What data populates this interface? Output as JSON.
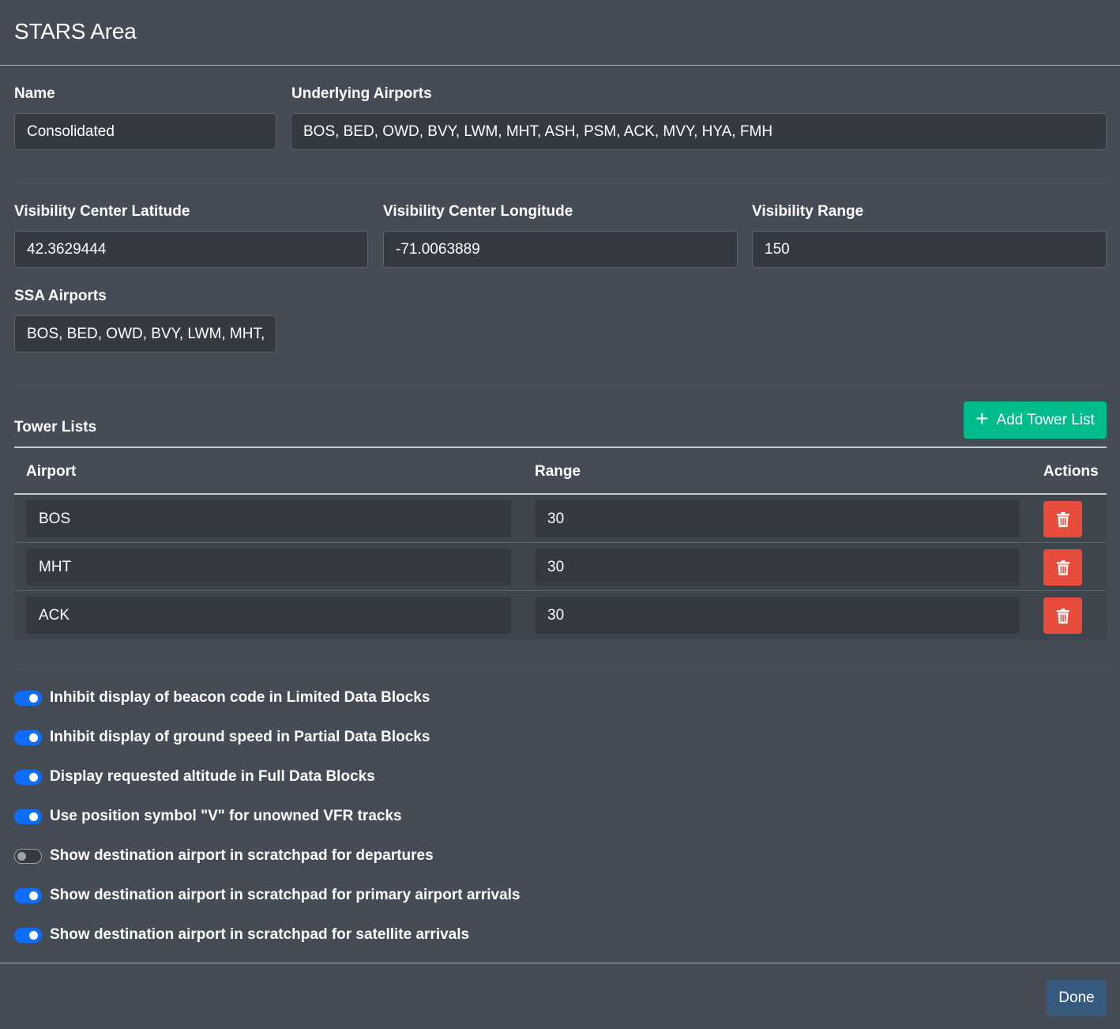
{
  "dialog": {
    "title": "STARS Area"
  },
  "fields": {
    "name": {
      "label": "Name",
      "value": "Consolidated"
    },
    "underlying_airports": {
      "label": "Underlying Airports",
      "value": "BOS, BED, OWD, BVY, LWM, MHT, ASH, PSM, ACK, MVY, HYA, FMH"
    },
    "latitude": {
      "label": "Visibility Center Latitude",
      "value": "42.3629444"
    },
    "longitude": {
      "label": "Visibility Center Longitude",
      "value": "-71.0063889"
    },
    "range": {
      "label": "Visibility Range",
      "value": "150"
    },
    "ssa_airports": {
      "label": "SSA Airports",
      "value": "BOS, BED, OWD, BVY, LWM, MHT, ASH"
    }
  },
  "tower_lists": {
    "heading": "Tower Lists",
    "add_button": "Add Tower List",
    "columns": {
      "airport": "Airport",
      "range": "Range",
      "actions": "Actions"
    },
    "rows": [
      {
        "airport": "BOS",
        "range": "30"
      },
      {
        "airport": "MHT",
        "range": "30"
      },
      {
        "airport": "ACK",
        "range": "30"
      }
    ]
  },
  "options": [
    {
      "label": "Inhibit display of beacon code in Limited Data Blocks",
      "checked": true
    },
    {
      "label": "Inhibit display of ground speed in Partial Data Blocks",
      "checked": true
    },
    {
      "label": "Display requested altitude in Full Data Blocks",
      "checked": true
    },
    {
      "label": "Use position symbol \"V\" for unowned VFR tracks",
      "checked": true
    },
    {
      "label": "Show destination airport in scratchpad for departures",
      "checked": false
    },
    {
      "label": "Show destination airport in scratchpad for primary airport arrivals",
      "checked": true
    },
    {
      "label": "Show destination airport in scratchpad for satellite arrivals",
      "checked": true
    }
  ],
  "footer": {
    "done_label": "Done"
  },
  "colors": {
    "background": "#454c55",
    "input_bg": "#353a42",
    "success": "#00bc8c",
    "danger": "#e74c3c",
    "primary": "#375a7f",
    "switch_on": "#0d6efd"
  },
  "icons": {
    "add": "plus-icon",
    "delete": "trash-icon"
  }
}
